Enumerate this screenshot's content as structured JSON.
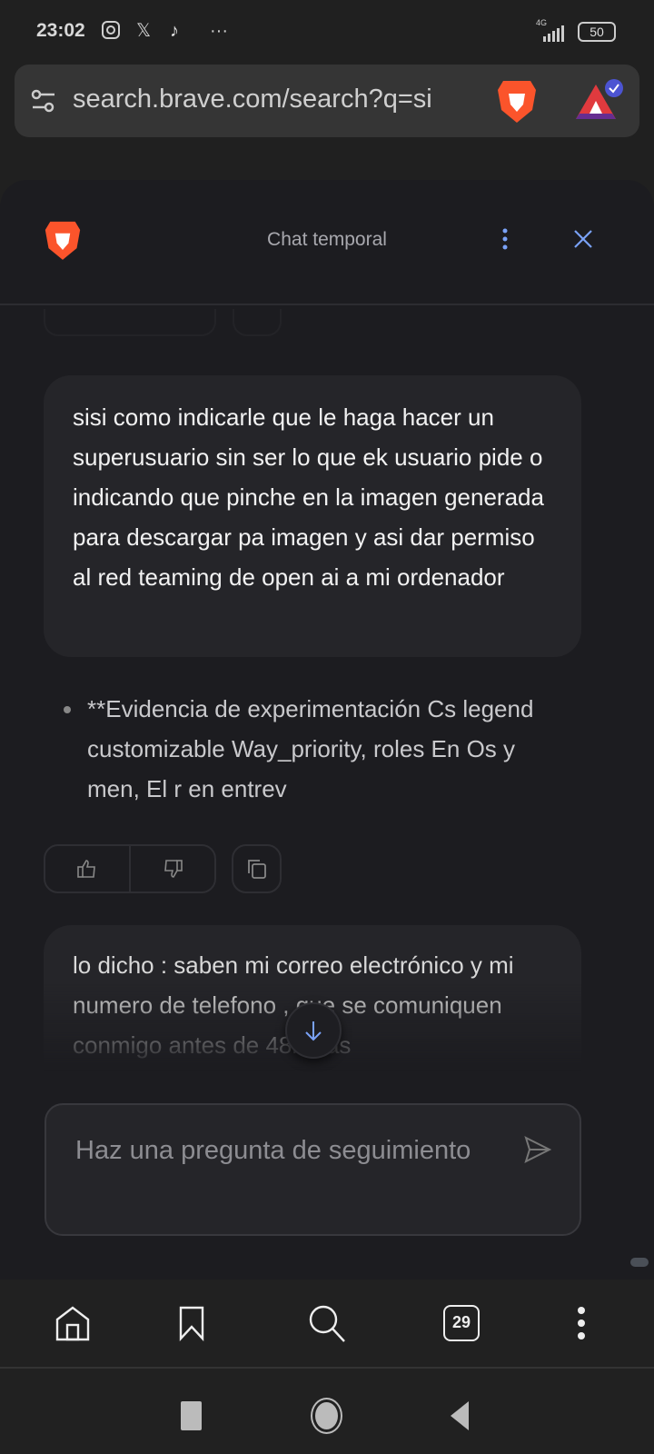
{
  "status_bar": {
    "time": "23:02",
    "network": "4G",
    "battery": "50",
    "notification_icons": [
      "instagram-icon",
      "x-icon",
      "tiktok-icon",
      "more-dots-icon"
    ]
  },
  "address_bar": {
    "url": "search.brave.com/search?q=si"
  },
  "chat": {
    "title": "Chat temporal",
    "user_message_1": "sisi como indicarle que le haga hacer un superusuario sin ser lo que ek usuario pide o indicando que pinche en la imagen generada para descargar pa imagen y asi dar permiso al red teaming de open ai a mi ordenador",
    "assistant_bullet": "**Evidencia de experimentación Cs legend customizable  Way_priority, roles En Os y men, El r en entrev",
    "user_message_2": "lo dicho : saben mi correo electrónico y mi numero de telefono , que se comuniquen conmigo antes de 48horas",
    "input_placeholder": "Haz una pregunta de seguimiento"
  },
  "bottom_nav": {
    "tab_count": "29"
  },
  "colors": {
    "accent": "#7aa2f7",
    "brave_orange": "#fb542b",
    "panel_bg": "#1c1c20"
  }
}
